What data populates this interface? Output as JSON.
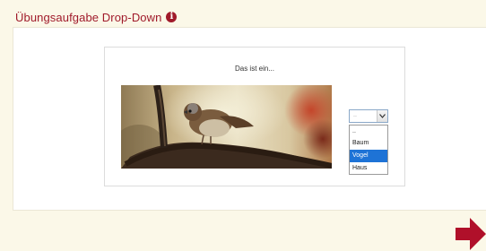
{
  "header": {
    "title": "Übungsaufgabe Drop-Down",
    "info_icon": "info-icon",
    "info_glyph": "i"
  },
  "task": {
    "question": "Das ist ein...",
    "image": "sparrow-on-branch",
    "dropdown": {
      "selected_value": "..",
      "options": [
        "..",
        "Baum",
        "Vogel",
        "Haus"
      ],
      "highlighted": "Vogel"
    }
  },
  "navigation": {
    "next_icon": "arrow-right-icon"
  },
  "colors": {
    "accent": "#a01a2a",
    "selection": "#1e73d6",
    "background": "#fbf8e8"
  }
}
